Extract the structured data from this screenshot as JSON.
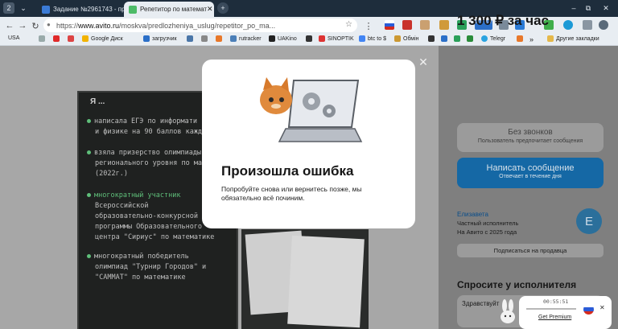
{
  "browser": {
    "workspace_badge": "2",
    "tabs": [
      {
        "label": "Задание №2961743 - про"
      },
      {
        "label": "Репетитор по математ"
      }
    ],
    "new_tab": "+",
    "window_controls": [
      "–",
      "⧉",
      "✕"
    ],
    "url": {
      "scheme": "https://",
      "host": "www.avito.ru",
      "path": "/moskva/predlozheniya_uslug/repetitor_po_ma..."
    },
    "bookmarks": [
      "USA",
      "Google Диск",
      "загрузчик",
      "rutracker",
      "UAKino",
      "SINOPTIK",
      "btc to $",
      "Обмін",
      "Telegr",
      "Другие закладки"
    ],
    "extension_badge": "LTC 95.2"
  },
  "listing": {
    "blackboard_title": "Я ...",
    "blackboard_lines": [
      "написала ЕГЭ по информати",
      "и физике на 90 баллов кажды",
      "взяла призерство олимпиады В",
      "регионального уровня по мате",
      "(2022г.)",
      "многократный участник",
      "Всероссийской",
      "образовательно-конкурсной",
      "программы Образовательного",
      "центра \"Сириус\" по математике",
      "многократный победитель",
      "олимпиад \"Турнир Городов\" и",
      "\"САММАТ\" по математике"
    ],
    "price": "1 300 ₽ за час",
    "no_calls_label": "Без звонков",
    "no_calls_sub": "Пользователь предпочитает сообщения",
    "write_label": "Написать сообщение",
    "write_sub": "Отвечает в течение дня",
    "seller_name": "Елизавета",
    "seller_type": "Частный исполнитель",
    "seller_since": "На Авито с 2025 года",
    "avatar_letter": "E",
    "subscribe_label": "Подписаться на продавца",
    "ask_title": "Спросите у исполнителя",
    "ask_placeholder": "Здравствуйт",
    "ask_partial": "Со"
  },
  "modal": {
    "title": "Произошла ошибка",
    "text": "Попробуйте снова или вернитесь позже, мы обязательно всё починим.",
    "close": "✕"
  },
  "player": {
    "time": "00:55:51",
    "premium": "Get Premium",
    "close": "✕"
  },
  "colors": {
    "accent_blue": "#1568a5",
    "chalk_green": "#5fbf7a"
  }
}
